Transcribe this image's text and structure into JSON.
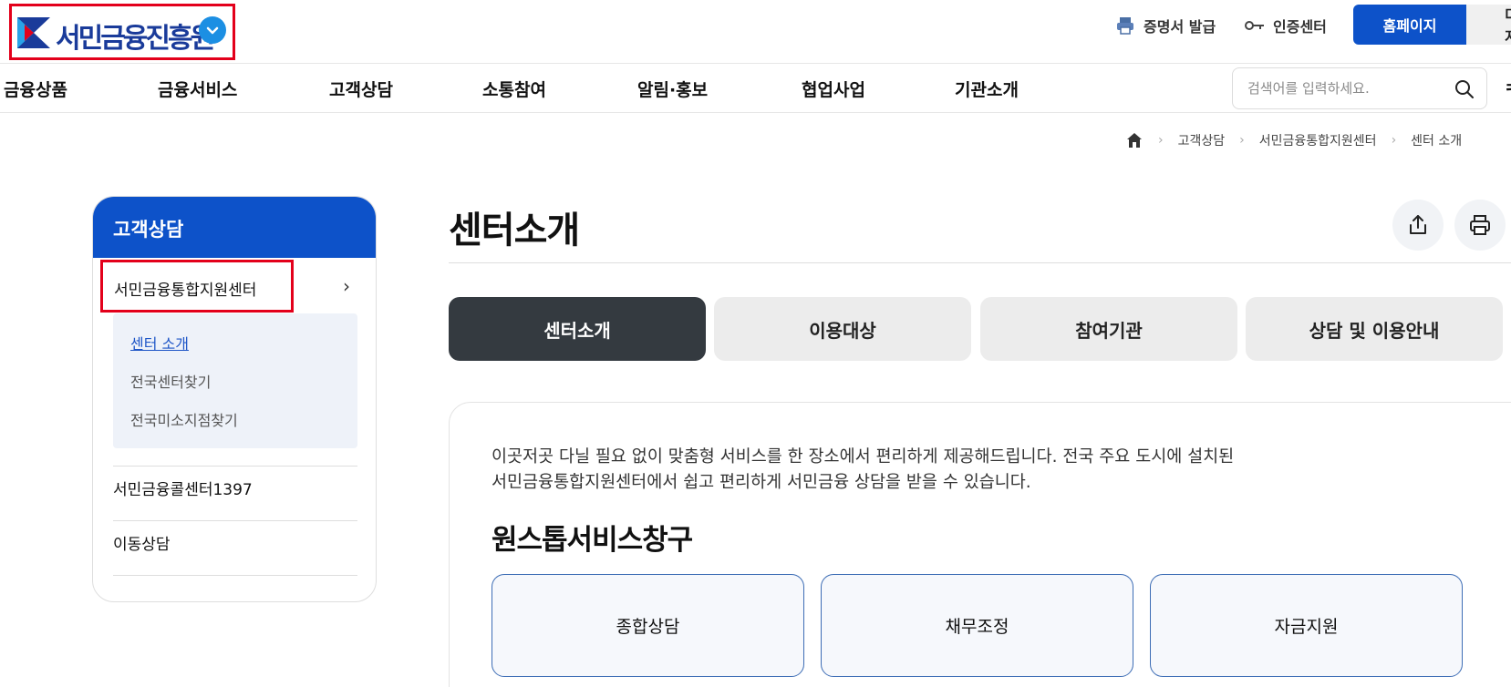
{
  "header": {
    "logo_text": "서민금융진흥원",
    "cert_label": "증명서 발급",
    "auth_label": "인증센터",
    "home_label": "홈페이지",
    "digital_label": "디지"
  },
  "gnb": {
    "items": [
      "금융상품",
      "금융서비스",
      "고객상담",
      "소통참여",
      "알림·홍보",
      "협업사업",
      "기관소개"
    ],
    "search_placeholder": "검색어를 입력하세요.",
    "all_menu_label": "ㅋ"
  },
  "breadcrumb": {
    "items": [
      "고객상담",
      "서민금융통합지원센터",
      "센터 소개"
    ]
  },
  "sidebar": {
    "title": "고객상담",
    "current_group": "서민금융통합지원센터",
    "sub_items": [
      "센터 소개",
      "전국센터찾기",
      "전국미소지점찾기"
    ],
    "links": [
      "서민금융콜센터1397",
      "이동상담"
    ]
  },
  "main": {
    "title": "센터소개",
    "tabs": [
      "센터소개",
      "이용대상",
      "참여기관",
      "상담 및 이용안내"
    ],
    "intro_line1": "이곳저곳 다닐 필요 없이 맞춤형 서비스를 한 장소에서 편리하게 제공해드립니다. 전국 주요 도시에 설치된",
    "intro_line2": "서민금융통합지원센터에서 쉽고 편리하게 서민금융 상담을 받을 수 있습니다.",
    "section_title": "원스톱서비스창구",
    "services": [
      "종합상담",
      "채무조정",
      "자금지원"
    ]
  },
  "colors": {
    "brand_blue": "#0d52c9",
    "active_tab": "#343a40",
    "highlight_red": "#e3001b"
  }
}
